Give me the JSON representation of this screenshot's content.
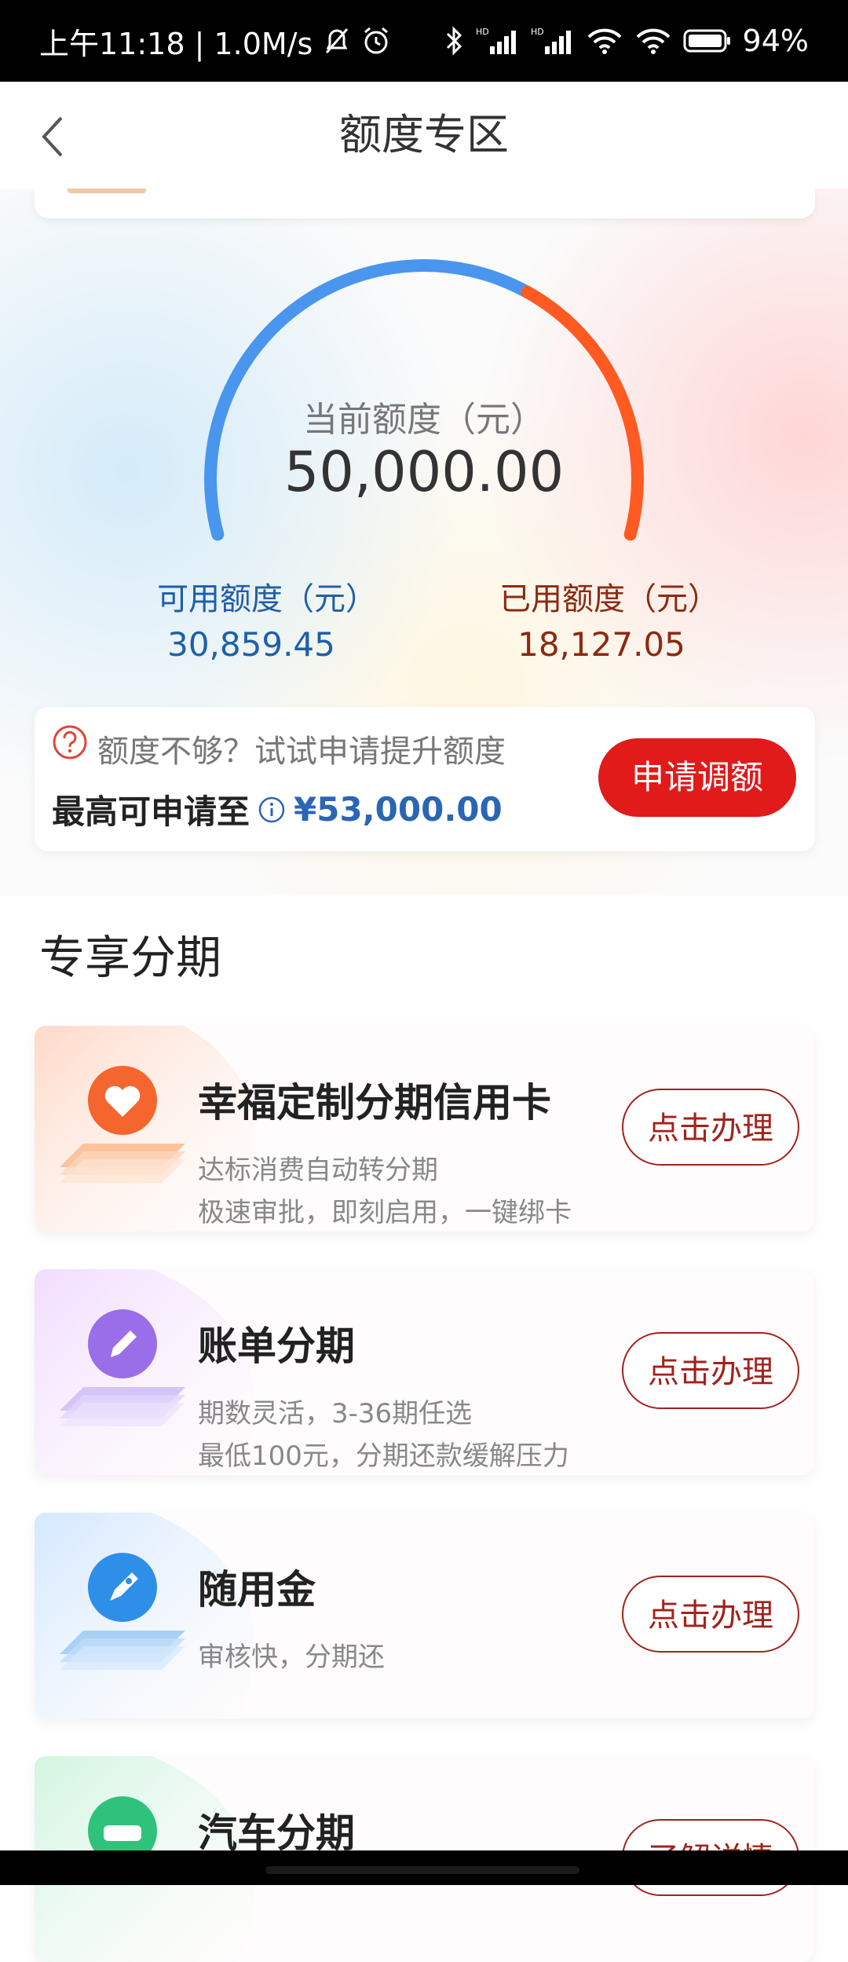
{
  "status_bar": {
    "time_text": "上午11:18 | 1.0M/s",
    "battery": "94%"
  },
  "nav": {
    "title": "额度专区"
  },
  "gauge": {
    "caption": "当前额度（元）",
    "total": "50,000.00",
    "used_fraction": 0.3625,
    "available_color": "#4a96ee",
    "used_color": "#ff5a22"
  },
  "available": {
    "label": "可用额度（元）",
    "value": "30,859.45"
  },
  "used": {
    "label": "已用额度（元）",
    "value": "18,127.05"
  },
  "raise": {
    "hint": "额度不够？试试申请提升额度",
    "max_label": "最高可申请至",
    "max_value": "¥53,000.00",
    "button": "申请调额"
  },
  "section": {
    "title": "专享分期"
  },
  "cards": [
    {
      "title": "幸福定制分期信用卡",
      "line1": "达标消费自动转分期",
      "line2": "极速审批，即刻启用，一键绑卡",
      "button": "点击办理",
      "icon": "heart-icon",
      "accent": "#f5652e"
    },
    {
      "title": "账单分期",
      "line1": "期数灵活，3-36期任选",
      "line2": "最低100元，分期还款缓解压力",
      "button": "点击办理",
      "icon": "pencil-icon",
      "accent": "#9a6ee8"
    },
    {
      "title": "随用金",
      "line1": "审核快，分期还",
      "line2": "",
      "button": "点击办理",
      "icon": "rocket-icon",
      "accent": "#2d8fe8"
    },
    {
      "title": "汽车分期",
      "line1": "",
      "line2": "",
      "button": "了解详情",
      "icon": "car-icon",
      "accent": "#2fc27a"
    }
  ]
}
